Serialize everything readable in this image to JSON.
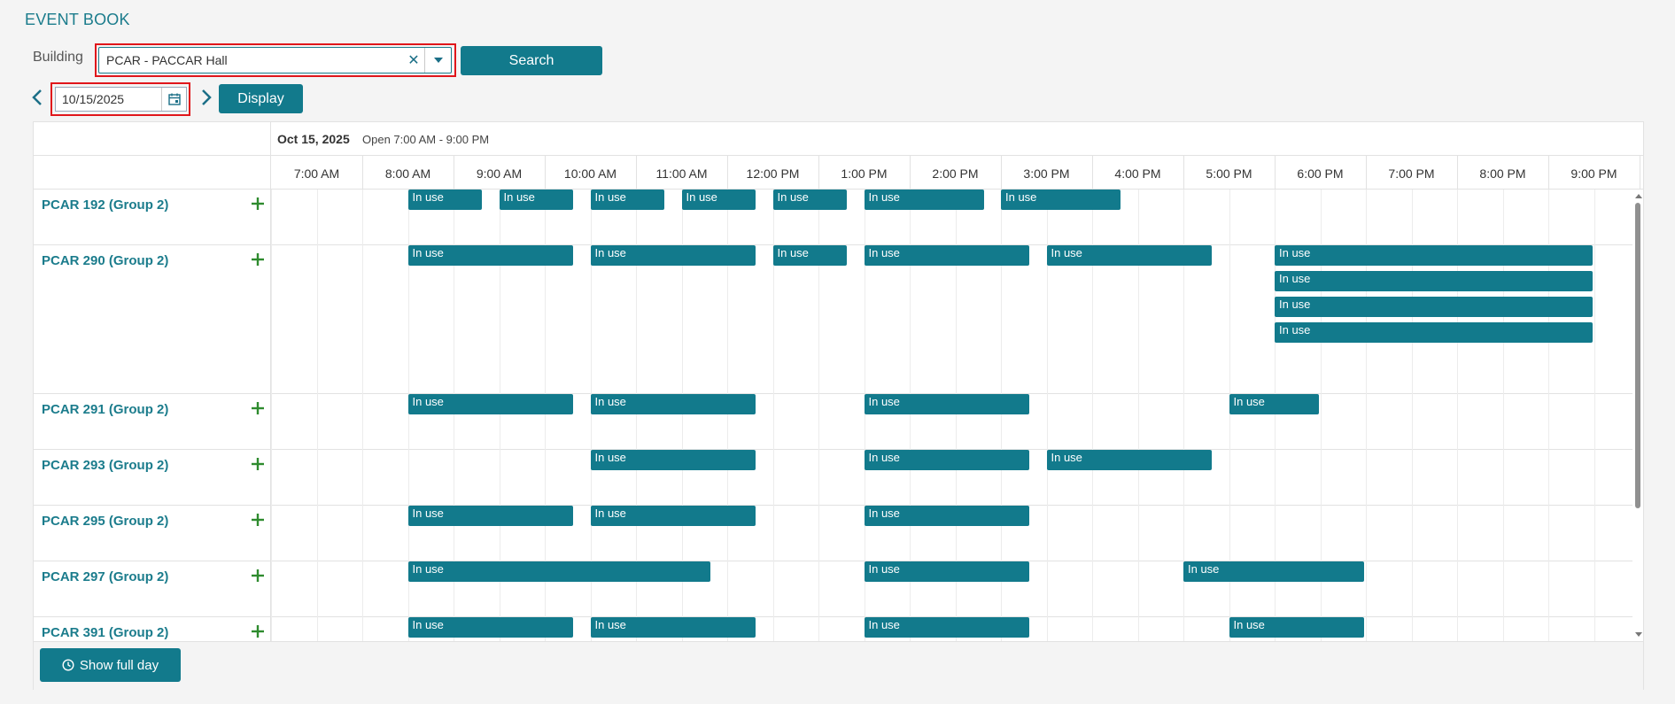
{
  "app": {
    "title": "EVENT BOOK"
  },
  "search": {
    "building_label": "Building",
    "building_value": "PCAR - PACCAR Hall",
    "search_label": "Search"
  },
  "date_nav": {
    "date_value": "10/15/2025",
    "display_label": "Display"
  },
  "schedule": {
    "date_title": "Oct 15, 2025",
    "open_hours": "Open 7:00 AM - 9:00 PM",
    "times": [
      "7:00 AM",
      "8:00 AM",
      "9:00 AM",
      "10:00 AM",
      "11:00 AM",
      "12:00 PM",
      "1:00 PM",
      "2:00 PM",
      "3:00 PM",
      "4:00 PM",
      "5:00 PM",
      "6:00 PM",
      "7:00 PM",
      "8:00 PM",
      "9:00 PM"
    ],
    "rooms": [
      {
        "name": "PCAR 192 (Group 2)",
        "bookings": [
          {
            "label": "In use",
            "start": "8:30 AM",
            "end": "9:20 AM",
            "lane": 0
          },
          {
            "label": "In use",
            "start": "9:30 AM",
            "end": "10:20 AM",
            "lane": 0
          },
          {
            "label": "In use",
            "start": "10:30 AM",
            "end": "11:20 AM",
            "lane": 0
          },
          {
            "label": "In use",
            "start": "11:30 AM",
            "end": "12:20 PM",
            "lane": 0
          },
          {
            "label": "In use",
            "start": "12:30 PM",
            "end": "1:20 PM",
            "lane": 0
          },
          {
            "label": "In use",
            "start": "1:30 PM",
            "end": "2:50 PM",
            "lane": 0
          },
          {
            "label": "In use",
            "start": "3:00 PM",
            "end": "4:20 PM",
            "lane": 0
          }
        ]
      },
      {
        "name": "PCAR 290 (Group 2)",
        "bookings": [
          {
            "label": "In use",
            "start": "8:30 AM",
            "end": "10:20 AM",
            "lane": 0
          },
          {
            "label": "In use",
            "start": "10:30 AM",
            "end": "12:20 PM",
            "lane": 0
          },
          {
            "label": "In use",
            "start": "12:30 PM",
            "end": "1:20 PM",
            "lane": 0
          },
          {
            "label": "In use",
            "start": "1:30 PM",
            "end": "3:20 PM",
            "lane": 0
          },
          {
            "label": "In use",
            "start": "3:30 PM",
            "end": "5:20 PM",
            "lane": 0
          },
          {
            "label": "In use",
            "start": "6:00 PM",
            "end": "9:30 PM",
            "lane": 0
          },
          {
            "label": "In use",
            "start": "6:00 PM",
            "end": "9:30 PM",
            "lane": 1
          },
          {
            "label": "In use",
            "start": "6:00 PM",
            "end": "9:30 PM",
            "lane": 2
          },
          {
            "label": "In use",
            "start": "6:00 PM",
            "end": "9:30 PM",
            "lane": 3
          }
        ]
      },
      {
        "name": "PCAR 291 (Group 2)",
        "bookings": [
          {
            "label": "In use",
            "start": "8:30 AM",
            "end": "10:20 AM",
            "lane": 0
          },
          {
            "label": "In use",
            "start": "10:30 AM",
            "end": "12:20 PM",
            "lane": 0
          },
          {
            "label": "In use",
            "start": "1:30 PM",
            "end": "3:20 PM",
            "lane": 0
          },
          {
            "label": "In use",
            "start": "5:30 PM",
            "end": "6:30 PM",
            "lane": 0
          }
        ]
      },
      {
        "name": "PCAR 293 (Group 2)",
        "bookings": [
          {
            "label": "In use",
            "start": "10:30 AM",
            "end": "12:20 PM",
            "lane": 0
          },
          {
            "label": "In use",
            "start": "1:30 PM",
            "end": "3:20 PM",
            "lane": 0
          },
          {
            "label": "In use",
            "start": "3:30 PM",
            "end": "5:20 PM",
            "lane": 0
          }
        ]
      },
      {
        "name": "PCAR 295 (Group 2)",
        "bookings": [
          {
            "label": "In use",
            "start": "8:30 AM",
            "end": "10:20 AM",
            "lane": 0
          },
          {
            "label": "In use",
            "start": "10:30 AM",
            "end": "12:20 PM",
            "lane": 0
          },
          {
            "label": "In use",
            "start": "1:30 PM",
            "end": "3:20 PM",
            "lane": 0
          }
        ]
      },
      {
        "name": "PCAR 297 (Group 2)",
        "bookings": [
          {
            "label": "In use",
            "start": "8:30 AM",
            "end": "11:50 AM",
            "lane": 0
          },
          {
            "label": "In use",
            "start": "1:30 PM",
            "end": "3:20 PM",
            "lane": 0
          },
          {
            "label": "In use",
            "start": "5:00 PM",
            "end": "7:00 PM",
            "lane": 0
          }
        ]
      },
      {
        "name": "PCAR 391 (Group 2)",
        "bookings": [
          {
            "label": "In use",
            "start": "8:30 AM",
            "end": "10:20 AM",
            "lane": 0
          },
          {
            "label": "In use",
            "start": "10:30 AM",
            "end": "12:20 PM",
            "lane": 0
          },
          {
            "label": "In use",
            "start": "1:30 PM",
            "end": "3:20 PM",
            "lane": 0
          },
          {
            "label": "In use",
            "start": "5:30 PM",
            "end": "7:00 PM",
            "lane": 0
          }
        ]
      }
    ]
  },
  "footer": {
    "show_full_day_label": "Show full day"
  },
  "colors": {
    "accent": "#127a8c",
    "link": "#1b7c8c",
    "add": "#2e8b2e",
    "highlight": "#e0161b"
  }
}
